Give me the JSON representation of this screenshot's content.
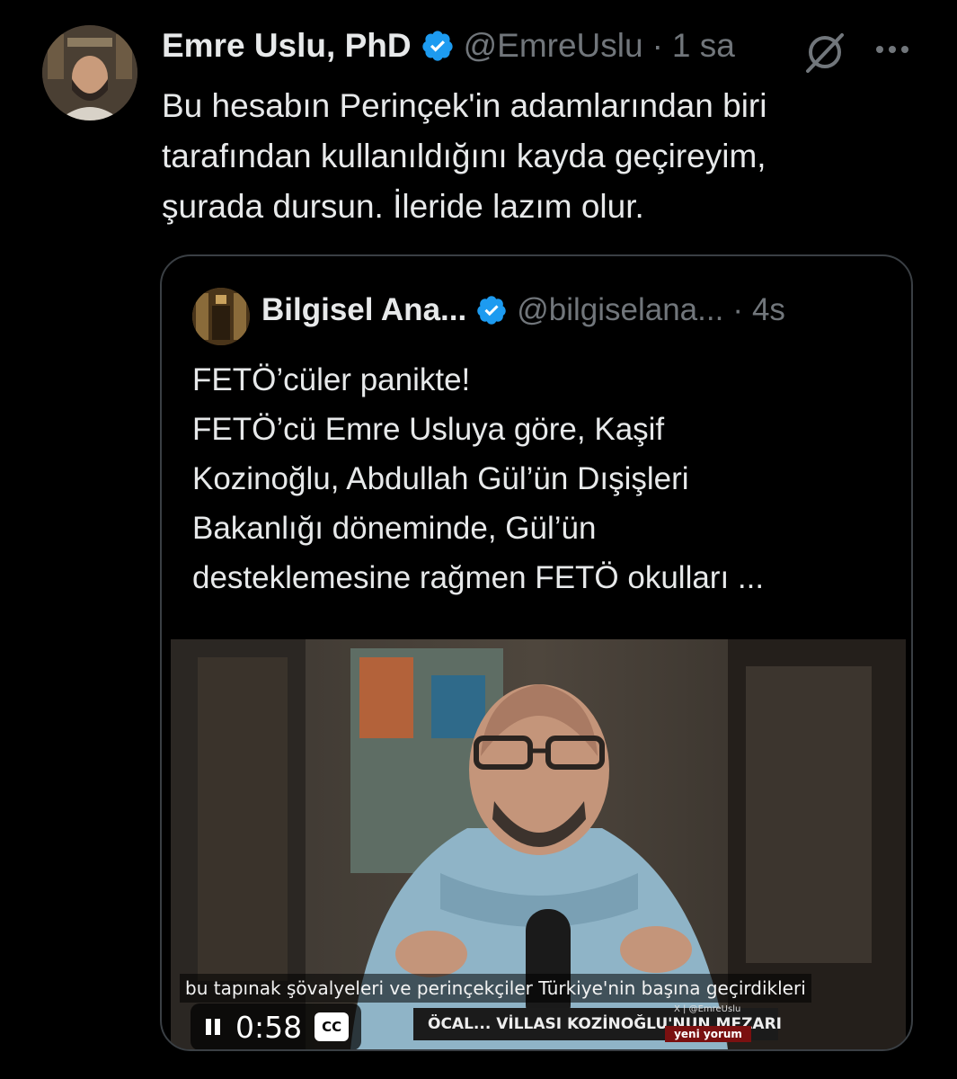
{
  "tweet": {
    "author_name": "Emre Uslu, PhD",
    "author_handle": "@EmreUslu",
    "separator": "·",
    "time": "1 sa",
    "text_lines": [
      "Bu hesabın Perinçek'in adamlarından biri",
      "tarafından kullanıldığını kayda geçireyim,",
      "şurada dursun. İleride lazım olur."
    ]
  },
  "quote": {
    "author_name": "Bilgisel Ana...",
    "author_handle": "@bilgiselana...",
    "separator": "·",
    "time": "4s",
    "text_lines": [
      "FETÖ’cüler panikte!",
      "FETÖ’cü Emre Usluya göre, Kaşif",
      "Kozinoğlu, Abdullah Gül’ün Dışişleri",
      "Bakanlığı döneminde, Gül’ün",
      "desteklemesine rağmen FETÖ okulları ..."
    ],
    "video": {
      "caption": "bu tapınak şövalyeleri ve perinçekçiler Türkiye'nin başına geçirdikleri",
      "timecode": "0:58",
      "cc_label": "CC",
      "ticker_text": "ÖCAL... VİLLASI KOZİNOĞLU'NUN MEZARI",
      "brand_text": "X | @EmreUslu",
      "show_name": "yeni yorum"
    }
  },
  "icons": {
    "verified": "verified-badge-icon",
    "grok": "grok-icon",
    "more": "more-options-icon",
    "pause": "pause-icon",
    "cc": "closed-captions-icon"
  },
  "colors": {
    "background": "#000000",
    "text": "#e7e9ea",
    "muted": "#71767b",
    "verified": "#1d9bf0",
    "border": "#3a3f44"
  }
}
